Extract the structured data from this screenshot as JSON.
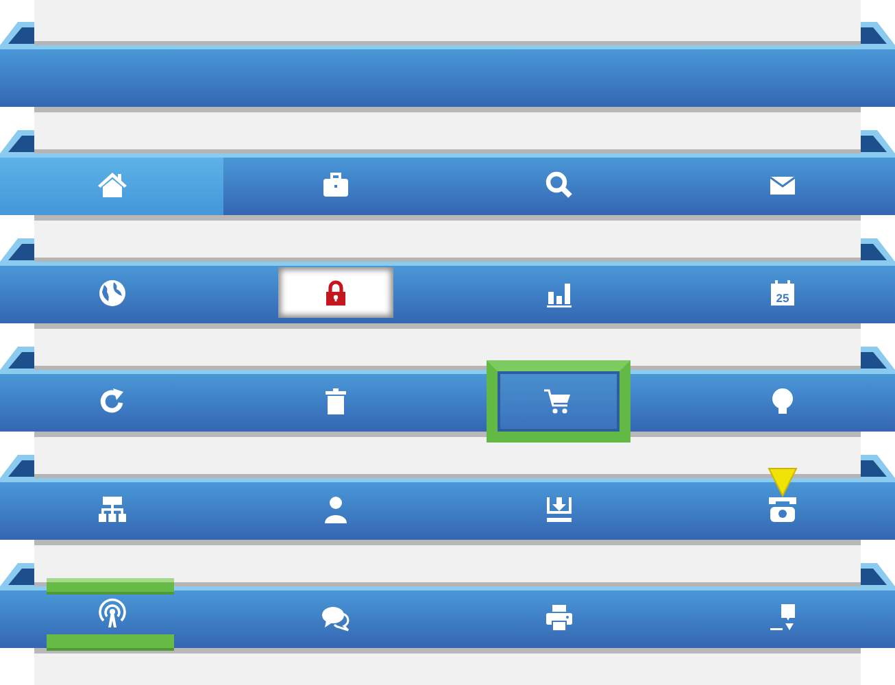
{
  "empty_bar": true,
  "bars": [
    {
      "kind": "highlight",
      "items": [
        {
          "selected": true
        },
        {
          "selected": false
        },
        {
          "selected": false
        },
        {
          "selected": false
        }
      ]
    },
    {
      "kind": "inset",
      "items": [
        {
          "selected": false
        },
        {
          "selected": true
        },
        {
          "selected": false
        },
        {
          "selected": false,
          "label": "25"
        }
      ]
    },
    {
      "kind": "outlined",
      "items": [
        {
          "selected": false
        },
        {
          "selected": false
        },
        {
          "selected": true
        },
        {
          "selected": false
        }
      ]
    },
    {
      "kind": "pointer",
      "items": [
        {
          "selected": false
        },
        {
          "selected": false
        },
        {
          "selected": false
        },
        {
          "selected": true
        }
      ]
    },
    {
      "kind": "tabs",
      "items": [
        {
          "selected": true
        },
        {
          "selected": false
        },
        {
          "selected": false
        },
        {
          "selected": false
        }
      ]
    }
  ]
}
